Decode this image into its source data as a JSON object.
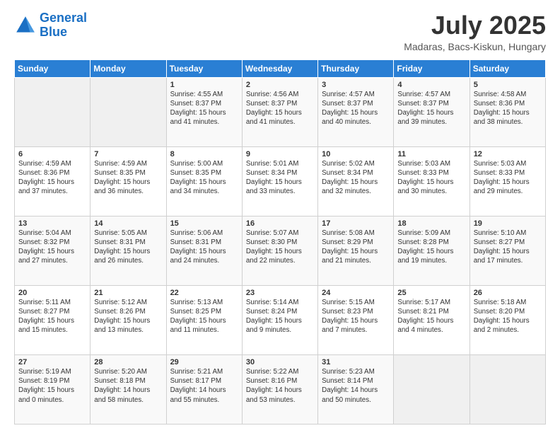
{
  "logo": {
    "line1": "General",
    "line2": "Blue"
  },
  "title": "July 2025",
  "subtitle": "Madaras, Bacs-Kiskun, Hungary",
  "header_days": [
    "Sunday",
    "Monday",
    "Tuesday",
    "Wednesday",
    "Thursday",
    "Friday",
    "Saturday"
  ],
  "weeks": [
    [
      {
        "day": "",
        "info": ""
      },
      {
        "day": "",
        "info": ""
      },
      {
        "day": "1",
        "info": "Sunrise: 4:55 AM\nSunset: 8:37 PM\nDaylight: 15 hours and 41 minutes."
      },
      {
        "day": "2",
        "info": "Sunrise: 4:56 AM\nSunset: 8:37 PM\nDaylight: 15 hours and 41 minutes."
      },
      {
        "day": "3",
        "info": "Sunrise: 4:57 AM\nSunset: 8:37 PM\nDaylight: 15 hours and 40 minutes."
      },
      {
        "day": "4",
        "info": "Sunrise: 4:57 AM\nSunset: 8:37 PM\nDaylight: 15 hours and 39 minutes."
      },
      {
        "day": "5",
        "info": "Sunrise: 4:58 AM\nSunset: 8:36 PM\nDaylight: 15 hours and 38 minutes."
      }
    ],
    [
      {
        "day": "6",
        "info": "Sunrise: 4:59 AM\nSunset: 8:36 PM\nDaylight: 15 hours and 37 minutes."
      },
      {
        "day": "7",
        "info": "Sunrise: 4:59 AM\nSunset: 8:35 PM\nDaylight: 15 hours and 36 minutes."
      },
      {
        "day": "8",
        "info": "Sunrise: 5:00 AM\nSunset: 8:35 PM\nDaylight: 15 hours and 34 minutes."
      },
      {
        "day": "9",
        "info": "Sunrise: 5:01 AM\nSunset: 8:34 PM\nDaylight: 15 hours and 33 minutes."
      },
      {
        "day": "10",
        "info": "Sunrise: 5:02 AM\nSunset: 8:34 PM\nDaylight: 15 hours and 32 minutes."
      },
      {
        "day": "11",
        "info": "Sunrise: 5:03 AM\nSunset: 8:33 PM\nDaylight: 15 hours and 30 minutes."
      },
      {
        "day": "12",
        "info": "Sunrise: 5:03 AM\nSunset: 8:33 PM\nDaylight: 15 hours and 29 minutes."
      }
    ],
    [
      {
        "day": "13",
        "info": "Sunrise: 5:04 AM\nSunset: 8:32 PM\nDaylight: 15 hours and 27 minutes."
      },
      {
        "day": "14",
        "info": "Sunrise: 5:05 AM\nSunset: 8:31 PM\nDaylight: 15 hours and 26 minutes."
      },
      {
        "day": "15",
        "info": "Sunrise: 5:06 AM\nSunset: 8:31 PM\nDaylight: 15 hours and 24 minutes."
      },
      {
        "day": "16",
        "info": "Sunrise: 5:07 AM\nSunset: 8:30 PM\nDaylight: 15 hours and 22 minutes."
      },
      {
        "day": "17",
        "info": "Sunrise: 5:08 AM\nSunset: 8:29 PM\nDaylight: 15 hours and 21 minutes."
      },
      {
        "day": "18",
        "info": "Sunrise: 5:09 AM\nSunset: 8:28 PM\nDaylight: 15 hours and 19 minutes."
      },
      {
        "day": "19",
        "info": "Sunrise: 5:10 AM\nSunset: 8:27 PM\nDaylight: 15 hours and 17 minutes."
      }
    ],
    [
      {
        "day": "20",
        "info": "Sunrise: 5:11 AM\nSunset: 8:27 PM\nDaylight: 15 hours and 15 minutes."
      },
      {
        "day": "21",
        "info": "Sunrise: 5:12 AM\nSunset: 8:26 PM\nDaylight: 15 hours and 13 minutes."
      },
      {
        "day": "22",
        "info": "Sunrise: 5:13 AM\nSunset: 8:25 PM\nDaylight: 15 hours and 11 minutes."
      },
      {
        "day": "23",
        "info": "Sunrise: 5:14 AM\nSunset: 8:24 PM\nDaylight: 15 hours and 9 minutes."
      },
      {
        "day": "24",
        "info": "Sunrise: 5:15 AM\nSunset: 8:23 PM\nDaylight: 15 hours and 7 minutes."
      },
      {
        "day": "25",
        "info": "Sunrise: 5:17 AM\nSunset: 8:21 PM\nDaylight: 15 hours and 4 minutes."
      },
      {
        "day": "26",
        "info": "Sunrise: 5:18 AM\nSunset: 8:20 PM\nDaylight: 15 hours and 2 minutes."
      }
    ],
    [
      {
        "day": "27",
        "info": "Sunrise: 5:19 AM\nSunset: 8:19 PM\nDaylight: 15 hours and 0 minutes."
      },
      {
        "day": "28",
        "info": "Sunrise: 5:20 AM\nSunset: 8:18 PM\nDaylight: 14 hours and 58 minutes."
      },
      {
        "day": "29",
        "info": "Sunrise: 5:21 AM\nSunset: 8:17 PM\nDaylight: 14 hours and 55 minutes."
      },
      {
        "day": "30",
        "info": "Sunrise: 5:22 AM\nSunset: 8:16 PM\nDaylight: 14 hours and 53 minutes."
      },
      {
        "day": "31",
        "info": "Sunrise: 5:23 AM\nSunset: 8:14 PM\nDaylight: 14 hours and 50 minutes."
      },
      {
        "day": "",
        "info": ""
      },
      {
        "day": "",
        "info": ""
      }
    ]
  ]
}
